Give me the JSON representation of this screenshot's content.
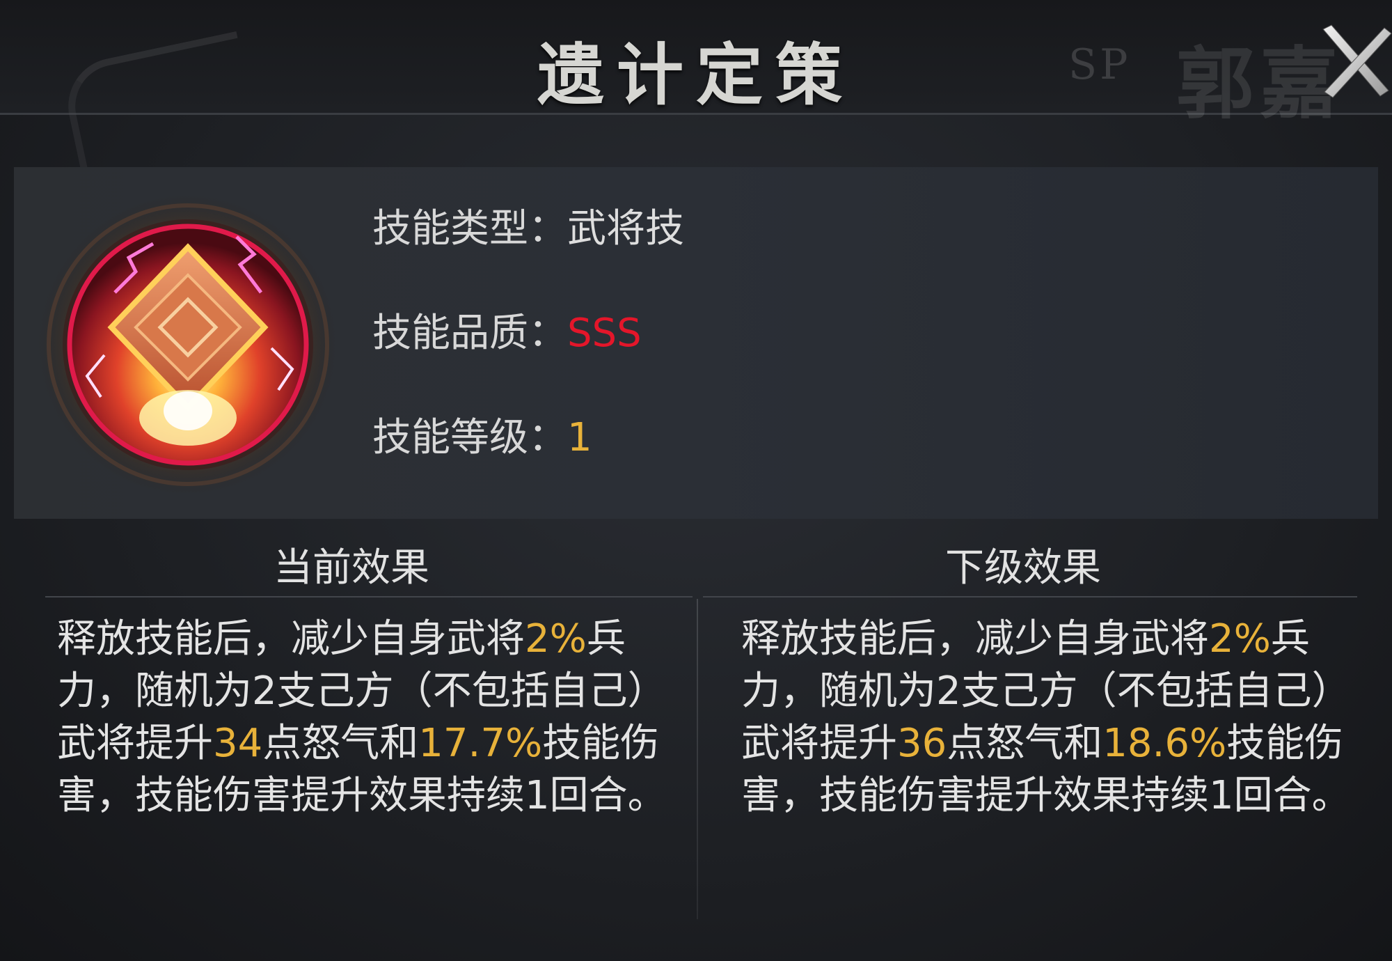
{
  "header": {
    "title": "遗计定策",
    "sp_tag": "SP",
    "hero_name": "郭嘉",
    "close_icon": "close-icon"
  },
  "skill": {
    "icon": "skill-diamond-lightning-icon",
    "type_label": "技能类型：",
    "type_value": "武将技",
    "quality_label": "技能品质：",
    "quality_value": "SSS",
    "level_label": "技能等级：",
    "level_value": "1"
  },
  "current": {
    "heading": "当前效果",
    "t1": "释放技能后，减少自身武将",
    "v1": "2%",
    "t2": "兵力，随机为2支己方（不包括自己）武将提升",
    "v2": "34",
    "t3": "点怒气和",
    "v3": "17.7%",
    "t4": "技能伤害，技能伤害提升效果持续1回合。"
  },
  "next": {
    "heading": "下级效果",
    "t1": "释放技能后，减少自身武将",
    "v1": "2%",
    "t2": "兵力，随机为2支己方（不包括自己）武将提升",
    "v2": "36",
    "t3": "点怒气和",
    "v3": "18.6%",
    "t4": "技能伤害，技能伤害提升效果持续1回合。"
  },
  "colors": {
    "quality_red": "#e4162a",
    "highlight_gold": "#e8b23a"
  }
}
